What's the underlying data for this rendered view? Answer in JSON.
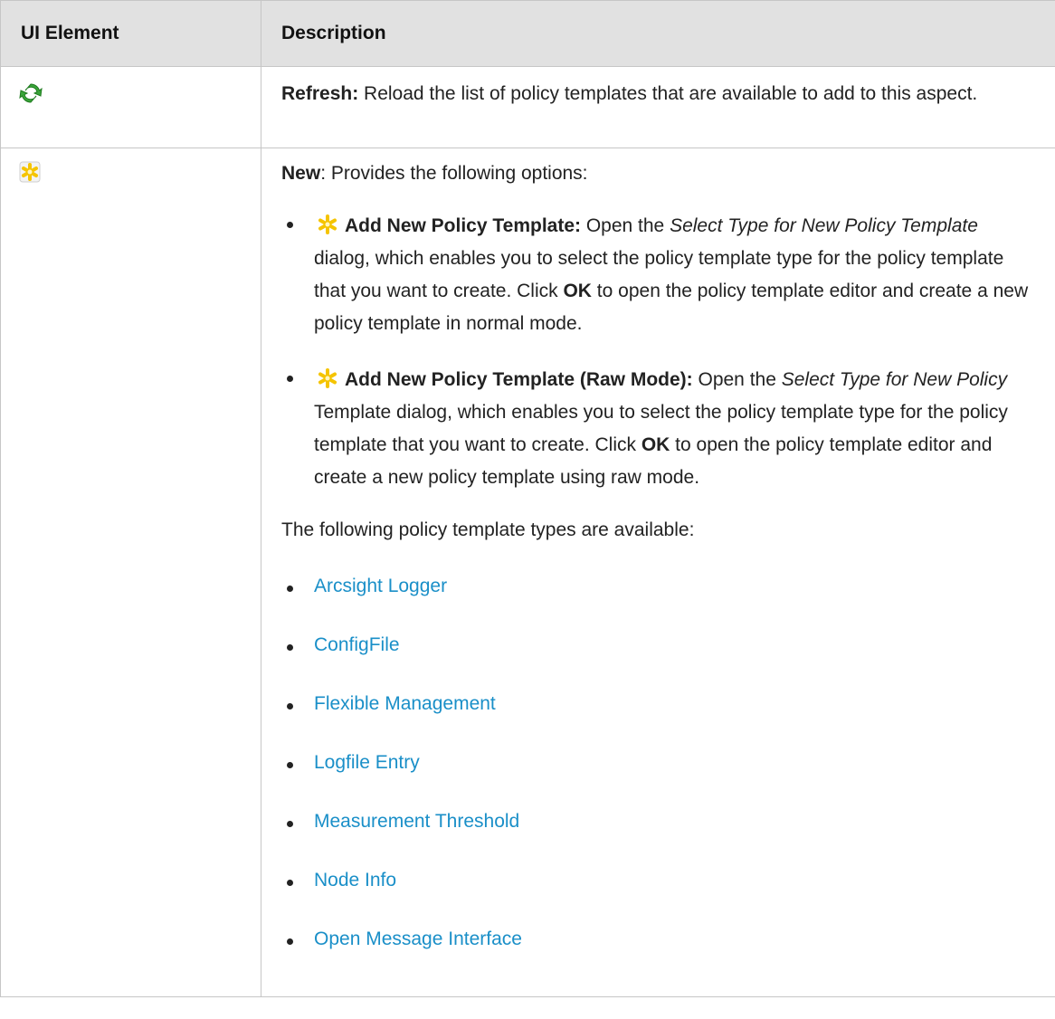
{
  "table": {
    "col1_header": "UI Element",
    "col2_header": "Description"
  },
  "refresh": {
    "icon": "refresh-icon",
    "label": "Refresh:",
    "text": " Reload the list of policy templates that are available to add to this aspect."
  },
  "new": {
    "icon": "new-asterisk-icon",
    "label": "New",
    "intro": ": Provides the following options:",
    "options": [
      {
        "label": "Add New Policy Template:",
        "pre": " Open the ",
        "italic": "Select Type for New Policy Template",
        "post": " dialog, which enables you to select the policy template type for the policy template that you want to create. Click ",
        "ok": "OK",
        "tail": " to open the policy template editor and create a new policy template in normal mode."
      },
      {
        "label": "Add New Policy Template (Raw Mode):",
        "pre": " Open the ",
        "italic": "Select Type for New Policy",
        "post": " Template dialog, which enables you to select the policy template type for the policy template that you want to create. Click ",
        "ok": "OK",
        "tail": " to open the policy template editor and create a new policy template using raw mode."
      }
    ],
    "types_intro": "The following policy template types are available:",
    "types": [
      "Arcsight Logger",
      "ConfigFile",
      "Flexible Management",
      "Logfile Entry",
      "Measurement Threshold",
      "Node Info",
      "Open Message Interface"
    ]
  },
  "colors": {
    "link": "#1a8fc8",
    "header_bg": "#e1e1e1",
    "refresh_green": "#3aa43a",
    "asterisk_yellow": "#f5c400"
  }
}
